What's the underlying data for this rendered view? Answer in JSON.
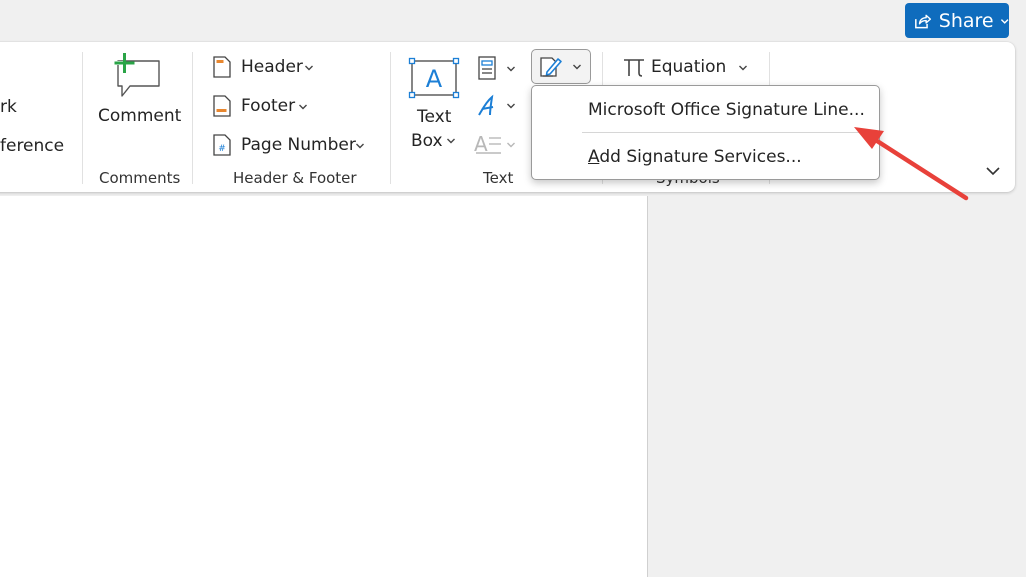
{
  "share": {
    "label": "Share"
  },
  "ribbon": {
    "partial": {
      "line1": "rk",
      "line2": "ference"
    },
    "comments": {
      "button_label": "Comment",
      "group_label": "Comments"
    },
    "header_footer": {
      "header": "Header",
      "footer": "Footer",
      "page_number": "Page Number",
      "group_label": "Header & Footer"
    },
    "text": {
      "textbox_line1": "Text",
      "textbox_line2": "Box",
      "group_label": "Text"
    },
    "symbols": {
      "equation": "Equation",
      "group_label": "Symbols"
    }
  },
  "signature_menu": {
    "items": [
      {
        "label": "Microsoft Office Signature Line..."
      },
      {
        "label_accel": "A",
        "label_rest": "dd Signature Services..."
      }
    ]
  },
  "annotation": {
    "arrow_color": "#e8413a"
  },
  "colors": {
    "accent": "#0f6cbd",
    "green_plus": "#2aa447",
    "icon_blue": "#1c7fd6"
  }
}
